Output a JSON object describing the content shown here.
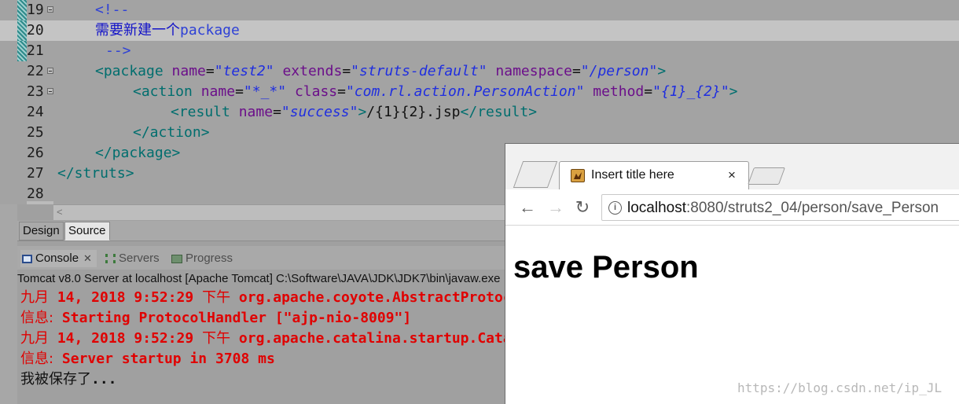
{
  "editor": {
    "lines": [
      {
        "n": "19",
        "parts": [
          [
            "cmt",
            "<!--"
          ]
        ],
        "indent": 121,
        "marker": true,
        "fold": true
      },
      {
        "n": "20",
        "parts": [
          [
            "cmtcn",
            "需要新建一个"
          ],
          [
            "cmt",
            "package"
          ]
        ],
        "indent": 121,
        "marker": true,
        "fold": false,
        "highlight": true
      },
      {
        "n": "21",
        "parts": [
          [
            "cmt",
            "-->"
          ]
        ],
        "indent": 134,
        "marker": true,
        "fold": false
      },
      {
        "n": "22",
        "parts": [
          [
            "tag",
            "<package "
          ],
          [
            "attr",
            "name"
          ],
          [
            "txt",
            "="
          ],
          [
            "val",
            "\"test2\""
          ],
          [
            "txt",
            " "
          ],
          [
            "attr",
            "extends"
          ],
          [
            "txt",
            "="
          ],
          [
            "val",
            "\"struts-default\""
          ],
          [
            "txt",
            " "
          ],
          [
            "attr",
            "namespace"
          ],
          [
            "txt",
            "="
          ],
          [
            "val",
            "\"/person\""
          ],
          [
            "tag",
            ">"
          ]
        ],
        "indent": 121,
        "fold": true
      },
      {
        "n": "23",
        "parts": [
          [
            "tag",
            "<action "
          ],
          [
            "attr",
            "name"
          ],
          [
            "txt",
            "="
          ],
          [
            "val",
            "\"*_*\""
          ],
          [
            "txt",
            " "
          ],
          [
            "attr",
            "class"
          ],
          [
            "txt",
            "="
          ],
          [
            "val",
            "\"com.rl.action.PersonAction\""
          ],
          [
            "txt",
            " "
          ],
          [
            "attr",
            "method"
          ],
          [
            "txt",
            "="
          ],
          [
            "val",
            "\"{1}_{2}\""
          ],
          [
            "tag",
            ">"
          ]
        ],
        "indent": 169,
        "fold": true
      },
      {
        "n": "24",
        "parts": [
          [
            "tag",
            "<result "
          ],
          [
            "attr",
            "name"
          ],
          [
            "txt",
            "="
          ],
          [
            "val",
            "\"success\""
          ],
          [
            "tag",
            ">"
          ],
          [
            "txt",
            "/{1}{2}.jsp"
          ],
          [
            "tag",
            "</result>"
          ]
        ],
        "indent": 217
      },
      {
        "n": "25",
        "parts": [
          [
            "tag",
            "</action>"
          ]
        ],
        "indent": 169
      },
      {
        "n": "26",
        "parts": [
          [
            "tag",
            "</package>"
          ]
        ],
        "indent": 121
      },
      {
        "n": "27",
        "parts": [
          [
            "tag",
            "</struts>"
          ]
        ],
        "indent": 73
      },
      {
        "n": "28",
        "parts": [],
        "indent": 73
      }
    ],
    "tabs": {
      "design": "Design",
      "source": "Source"
    }
  },
  "console": {
    "tabs": {
      "console": "Console",
      "close": "✕",
      "servers": "Servers",
      "progress": "Progress"
    },
    "header": "Tomcat v8.0 Server at localhost [Apache Tomcat] C:\\Software\\JAVA\\JDK\\JDK7\\bin\\javaw.exe",
    "lines": [
      {
        "color": "red",
        "cn": "九月",
        "text": " 14, 2018 9:52:29 ",
        "cn2": "下午",
        "text2": " org.apache.coyote.AbstractProtocol start"
      },
      {
        "color": "red",
        "cn": "信息:",
        "text": " Starting ProtocolHandler [\"ajp-nio-8009\"]",
        "cn2": "",
        "text2": ""
      },
      {
        "color": "red",
        "cn": "九月",
        "text": " 14, 2018 9:52:29 ",
        "cn2": "下午",
        "text2": " org.apache.catalina.startup.Catalina start"
      },
      {
        "color": "red",
        "cn": "信息:",
        "text": " Server startup in 3708 ms",
        "cn2": "",
        "text2": ""
      },
      {
        "color": "black",
        "cn": "我被保存了",
        "text": "...",
        "cn2": "",
        "text2": ""
      }
    ]
  },
  "browser": {
    "tab_title": "Insert title here",
    "tab_close": "×",
    "nav": {
      "back": "←",
      "forward": "→",
      "reload": "↻",
      "info": "i"
    },
    "url_host": "localhost",
    "url_rest": ":8080/struts2_04/person/save_Person",
    "page_heading": "save Person"
  },
  "watermark": "https://blog.csdn.net/ip_JL"
}
